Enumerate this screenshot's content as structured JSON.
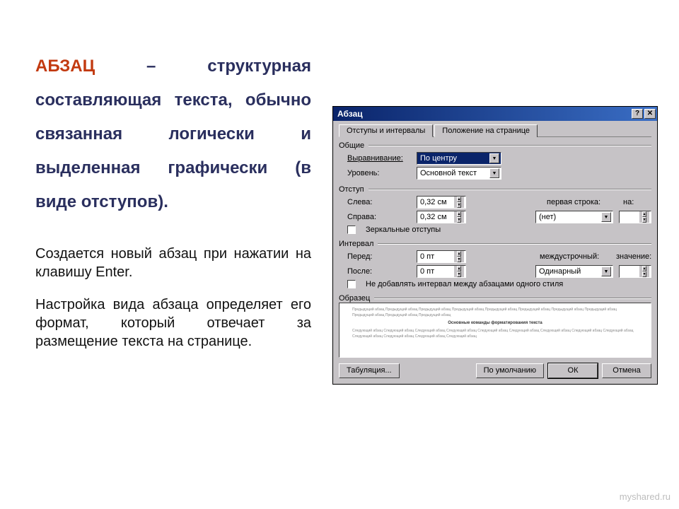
{
  "text": {
    "term": "АБЗАЦ",
    "definition_rest": " – структурная составляющая текста, обычно связанная логически и выделенная графически (в виде отступов).",
    "para1": "Создается новый абзац при нажатии на клавишу Enter.",
    "para2": "Настройка вида абзаца определяет его формат, который отвечает за размещение текста на странице."
  },
  "dialog": {
    "title": "Абзац",
    "help_btn": "?",
    "close_btn": "✕",
    "tabs": {
      "t1": "Отступы и интервалы",
      "t2": "Положение на странице"
    },
    "groups": {
      "general": "Общие",
      "indent": "Отступ",
      "spacing": "Интервал",
      "preview": "Образец"
    },
    "labels": {
      "alignment": "Выравнивание:",
      "outline": "Уровень:",
      "left": "Слева:",
      "right": "Справа:",
      "mirror": "Зеркальные отступы",
      "before": "Перед:",
      "after": "После:",
      "nospace": "Не добавлять интервал между абзацами одного стиля",
      "firstline": "первая строка:",
      "by": "на:",
      "linespacing": "междустрочный:",
      "value": "значение:"
    },
    "values": {
      "alignment": "По центру",
      "outline": "Основной текст",
      "left": "0,32 см",
      "right": "0,32 см",
      "firstline": "(нет)",
      "before": "0 пт",
      "after": "0 пт",
      "linespacing": "Одинарный"
    },
    "preview": {
      "l1": "Предыдущий абзац Предыдущий абзац Предыдущий абзац Предыдущий абзац Предыдущий абзац Предыдущий абзац Предыдущий абзац Предыдущий абзац Предыдущий абзац Предыдущий абзац Предыдущий абзац",
      "heading": "Основные команды форматирования текста",
      "l2": "Следующий абзац Следующий абзац Следующий абзац Следующий абзац Следующий абзац Следующий абзац Следующий абзац Следующий абзац Следующий абзац Следующий абзац Следующий абзац Следующий абзац Следующий абзац"
    },
    "buttons": {
      "tabs": "Табуляция...",
      "default": "По умолчанию",
      "ok": "ОК",
      "cancel": "Отмена"
    }
  },
  "watermark": "myshared.ru"
}
